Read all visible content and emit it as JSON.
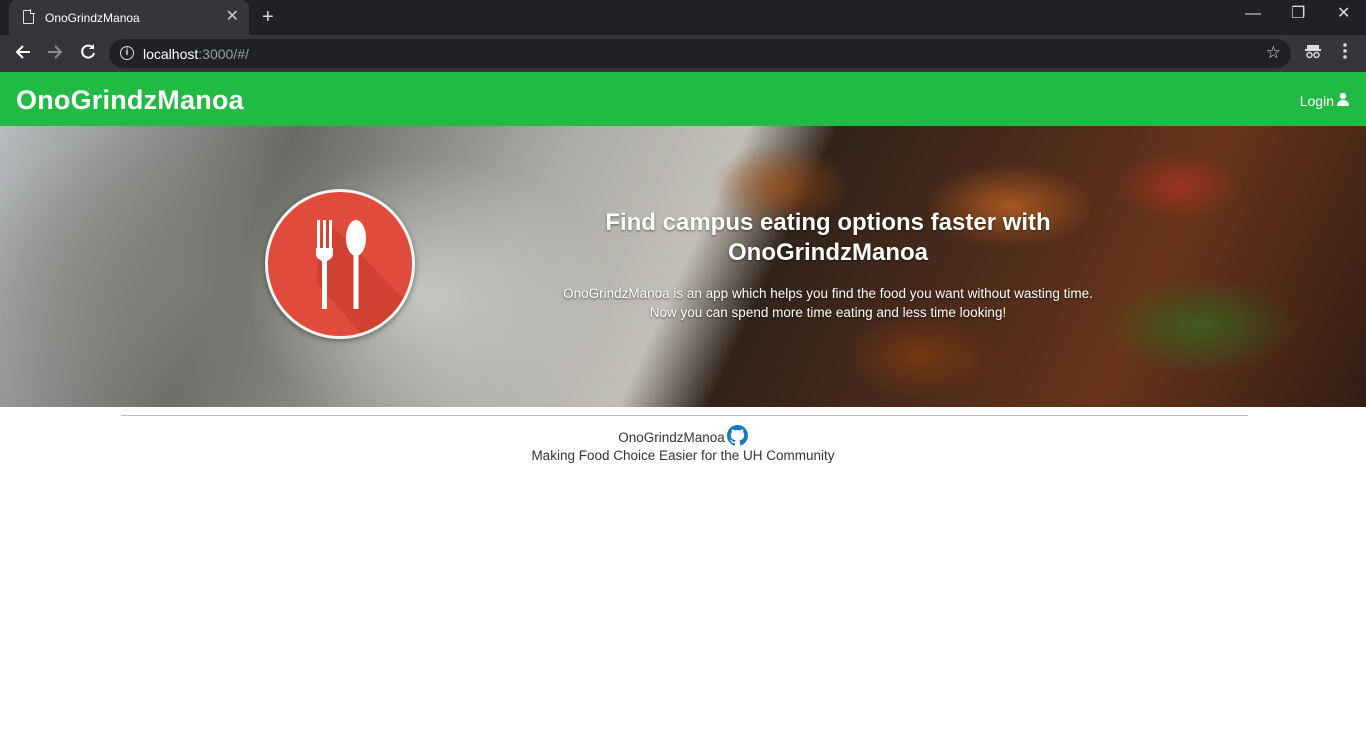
{
  "browser": {
    "tab_title": "OnoGrindzManoa",
    "url_host": "localhost",
    "url_rest": ":3000/#/"
  },
  "nav": {
    "brand": "OnoGrindzManoa",
    "login_label": "Login"
  },
  "hero": {
    "title_line1": "Find campus eating options faster with",
    "title_line2": "OnoGrindzManoa",
    "text_line1": "OnoGrindzManoa is an app which helps you find the food you want without wasting time.",
    "text_line2": "Now you can spend more time eating and less time looking!"
  },
  "footer": {
    "name": "OnoGrindzManoa",
    "tagline": "Making Food Choice Easier for the UH Community"
  },
  "colors": {
    "nav_green": "#21ba45",
    "logo_red": "#e14b3b",
    "github_blue": "#1678c2"
  },
  "icons": [
    "document-icon",
    "close-icon",
    "plus-icon",
    "back-icon",
    "forward-icon",
    "reload-icon",
    "info-icon",
    "star-icon",
    "incognito-icon",
    "menu-icon",
    "user-icon",
    "fork-spoon-icon",
    "github-icon"
  ]
}
